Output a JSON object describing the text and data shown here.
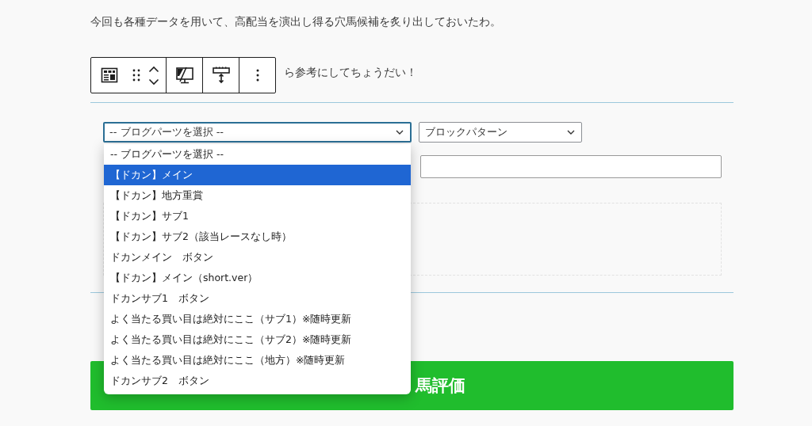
{
  "paragraphs": [
    {
      "text": "今回も各種データを用いて、高配当を演出し得る穴馬候補を炙り出しておいたわ。"
    },
    {
      "text": "ら参考にしてちょうだい！"
    }
  ],
  "parts_select": {
    "value": "-- ブログパーツを選択 --",
    "expanded": true,
    "options": [
      {
        "label": "-- ブログパーツを選択 --",
        "highlighted": false
      },
      {
        "label": "【ドカン】メイン",
        "highlighted": true
      },
      {
        "label": "【ドカン】地方重賞",
        "highlighted": false
      },
      {
        "label": "【ドカン】サブ1",
        "highlighted": false
      },
      {
        "label": "【ドカン】サブ2（該当レースなし時）",
        "highlighted": false
      },
      {
        "label": "ドカンメイン　ボタン",
        "highlighted": false
      },
      {
        "label": "【ドカン】メイン（short.ver）",
        "highlighted": false
      },
      {
        "label": "ドカンサブ1　ボタン",
        "highlighted": false
      },
      {
        "label": "よく当たる買い目は絶対にここ（サブ1）※随時更新",
        "highlighted": false
      },
      {
        "label": "よく当たる買い目は絶対にここ（サブ2）※随時更新",
        "highlighted": false
      },
      {
        "label": "よく当たる買い目は絶対にここ（地方）※随時更新",
        "highlighted": false
      },
      {
        "label": "ドカンサブ2　ボタン",
        "highlighted": false
      }
    ]
  },
  "pattern_select": {
    "value": "ブロックパターン"
  },
  "banner": {
    "text": "馬評価"
  }
}
